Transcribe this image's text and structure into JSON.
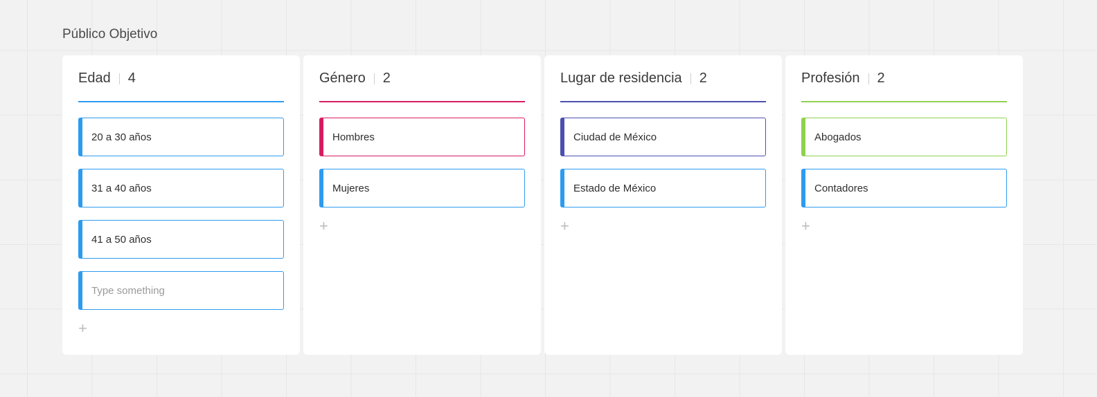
{
  "board": {
    "title": "Público Objetivo"
  },
  "colors": {
    "blue": "#2d9bf0",
    "pink": "#d81b60",
    "indigo": "#4b4fb0",
    "green": "#8fd14f",
    "background": "#f2f2f2"
  },
  "icons": {
    "add": "plus-icon"
  },
  "add_symbol": "+",
  "columns": [
    {
      "name": "Edad",
      "count": "4",
      "cards": [
        {
          "text": "20 a 30 años"
        },
        {
          "text": "31 a 40 años"
        },
        {
          "text": "41 a 50 años"
        }
      ],
      "new_card_placeholder": "Type something"
    },
    {
      "name": "Género",
      "count": "2",
      "cards": [
        {
          "text": "Hombres"
        },
        {
          "text": "Mujeres"
        }
      ]
    },
    {
      "name": "Lugar de residencia",
      "count": "2",
      "cards": [
        {
          "text": "Ciudad de México"
        },
        {
          "text": "Estado de México"
        }
      ]
    },
    {
      "name": "Profesión",
      "count": "2",
      "cards": [
        {
          "text": "Abogados"
        },
        {
          "text": "Contadores"
        }
      ]
    }
  ]
}
